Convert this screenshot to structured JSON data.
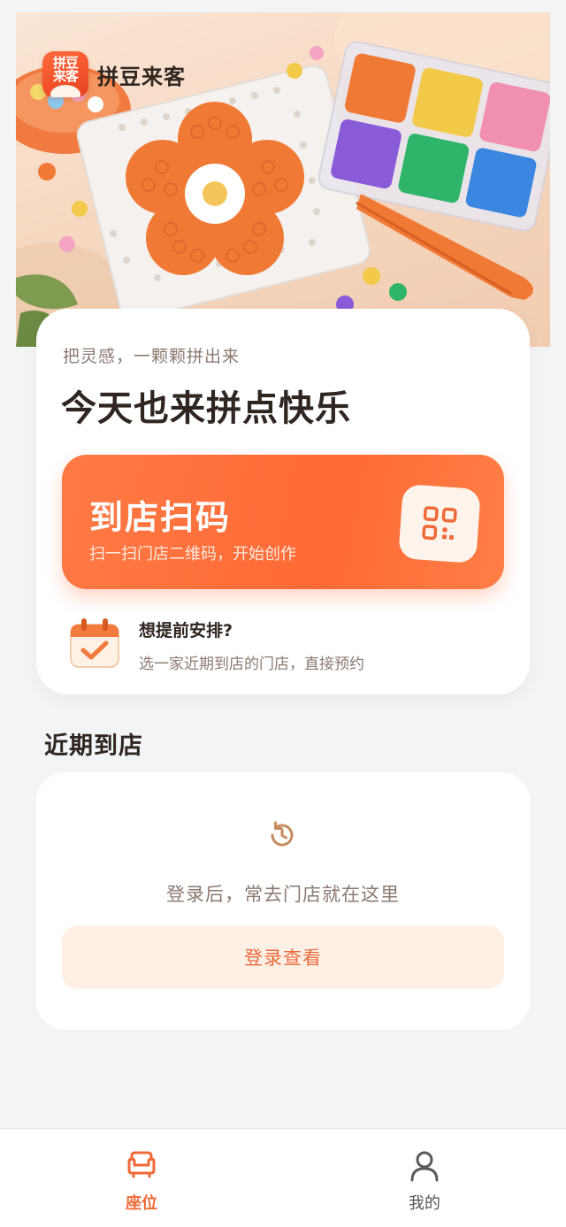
{
  "brand": {
    "name": "拼豆来客",
    "logo_line1": "拼豆",
    "logo_line2": "来客"
  },
  "hero_card": {
    "tagline": "把灵感，一颗颗拼出来",
    "headline": "今天也来拼点快乐"
  },
  "scan_button": {
    "title": "到店扫码",
    "subtitle": "扫一扫门店二维码，开始创作",
    "icon": "qr-code-icon"
  },
  "plan": {
    "title": "想提前安排?",
    "description": "选一家近期到店的门店，直接预约",
    "icon": "calendar-check-icon"
  },
  "recent": {
    "section_title": "近期到店",
    "empty_text": "登录后，常去门店就在这里",
    "login_button": "登录查看",
    "icon": "history-icon"
  },
  "tabbar": {
    "tabs": [
      {
        "label": "座位",
        "icon": "sofa-icon",
        "active": true
      },
      {
        "label": "我的",
        "icon": "user-icon",
        "active": false
      }
    ]
  },
  "colors": {
    "accent": "#ff6a35",
    "accent_text": "#e96b3c",
    "background": "#f3f4f6",
    "text_primary": "#2f2521",
    "text_secondary": "#8a7a70"
  }
}
